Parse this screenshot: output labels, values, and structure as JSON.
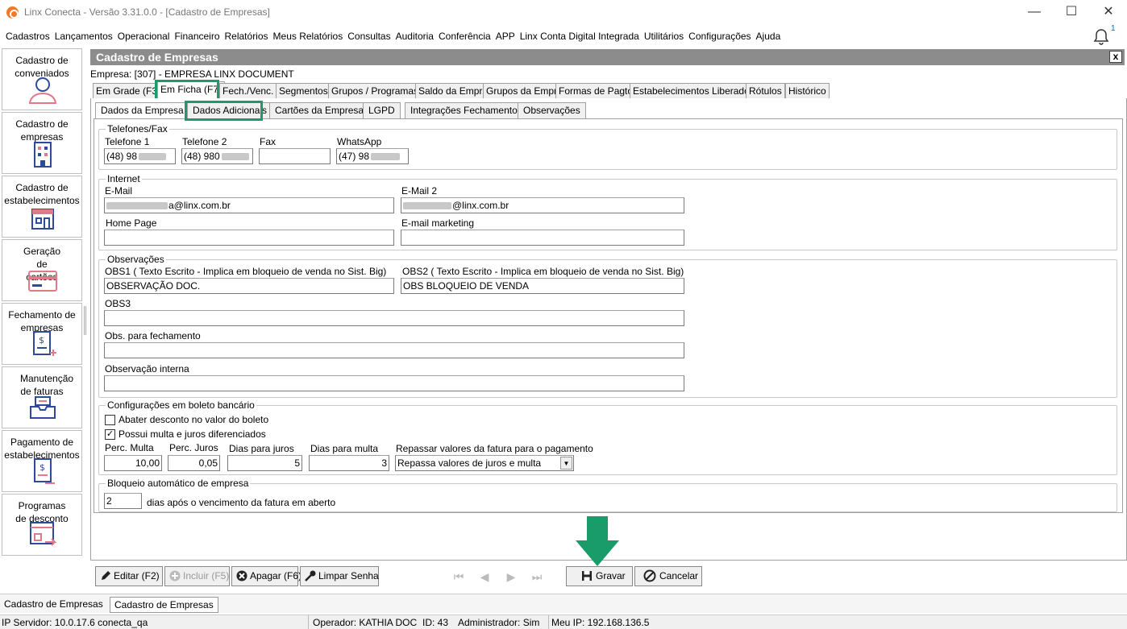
{
  "window": {
    "title": "Linx Conecta - Versão 3.31.0.0 - [Cadastro de Empresas]",
    "minimize": "—",
    "maximize": "☐",
    "close": "✕"
  },
  "menu": [
    "Cadastros",
    "Lançamentos",
    "Operacional",
    "Financeiro",
    "Relatórios",
    "Meus Relatórios",
    "Consultas",
    "Auditoria",
    "Conferência",
    "APP",
    "Linx Conta Digital Integrada",
    "Utilitários",
    "Configurações",
    "Ajuda"
  ],
  "notifications": {
    "count": "1"
  },
  "sidebar": [
    {
      "label": "Cadastro de conveniados",
      "icon": "user-icon"
    },
    {
      "label": "Cadastro de empresas",
      "icon": "building-icon"
    },
    {
      "label": "Cadastro de estabelecimentos",
      "icon": "store-icon"
    },
    {
      "label": "Geração de cartões",
      "icon": "card-icon"
    },
    {
      "label": "Fechamento de empresas",
      "icon": "invoice-icon"
    },
    {
      "label": "Manutenção de faturas",
      "icon": "inbox-icon"
    },
    {
      "label": "Pagamento de estabelecimentos",
      "icon": "payment-icon"
    },
    {
      "label": "Programas de desconto",
      "icon": "discount-icon"
    }
  ],
  "main": {
    "header": "Cadastro de Empresas",
    "close": "x",
    "empresa": "Empresa: [307] - EMPRESA LINX DOCUMENT"
  },
  "tabs": [
    "Em Grade (F3)",
    "Em Ficha (F7)",
    "Fech./Venc.",
    "Segmentos",
    "Grupos / Programas",
    "Saldo da Empr.",
    "Grupos da Empr.",
    "Formas de Pagto",
    "Estabelecimentos Liberados",
    "Rótulos",
    "Histórico"
  ],
  "subtabs": [
    "Dados da Empresa",
    "Dados Adicionais",
    "Cartões da Empresa",
    "LGPD",
    "Integrações Fechamento",
    "Observações"
  ],
  "telefones": {
    "title": "Telefones/Fax",
    "tel1_label": "Telefone 1",
    "tel1_value": "(48) 98",
    "tel2_label": "Telefone 2",
    "tel2_value": "(48) 980",
    "fax_label": "Fax",
    "fax_value": "",
    "whatsapp_label": "WhatsApp",
    "whatsapp_value": "(47) 98"
  },
  "internet": {
    "title": "Internet",
    "email_label": "E-Mail",
    "email_value": "a@linx.com.br",
    "email2_label": "E-Mail 2",
    "email2_value": "@linx.com.br",
    "homepage_label": "Home Page",
    "homepage_value": "",
    "marketing_label": "E-mail marketing",
    "marketing_value": ""
  },
  "observacoes": {
    "title": "Observações",
    "obs1_label": "OBS1 ( Texto Escrito - Implica em bloqueio de venda no Sist. Big)",
    "obs1_value": "OBSERVAÇÃO DOC.",
    "obs2_label": "OBS2 ( Texto Escrito - Implica em bloqueio de venda no Sist. Big)",
    "obs2_value": "OBS BLOQUEIO DE VENDA",
    "obs3_label": "OBS3",
    "obs3_value": "",
    "fechamento_label": "Obs. para fechamento",
    "fechamento_value": "",
    "interna_label": "Observação interna",
    "interna_value": ""
  },
  "boleto": {
    "title": "Configurações em boleto bancário",
    "abater_label": "Abater desconto no valor do boleto",
    "abater_checked": false,
    "multa_juros_label": "Possui multa e juros diferenciados",
    "multa_juros_checked": true,
    "perc_multa_label": "Perc. Multa",
    "perc_multa_value": "10,00",
    "perc_juros_label": "Perc. Juros",
    "perc_juros_value": "0,05",
    "dias_juros_label": "Dias para juros",
    "dias_juros_value": "5",
    "dias_multa_label": "Dias para multa",
    "dias_multa_value": "3",
    "repassar_label": "Repassar valores da fatura para o pagamento",
    "repassar_value": "Repassa valores de juros e multa",
    "check_mark": "✓",
    "dropdown_arrow": "▼"
  },
  "bloqueio": {
    "title": "Bloqueio automático de empresa",
    "dias_value": "2",
    "dias_suffix": "dias após o vencimento da fatura em aberto"
  },
  "toolbar": {
    "editar": "Editar (F2)",
    "incluir": "Incluir (F5)",
    "apagar": "Apagar (F6)",
    "limpar": "Limpar Senha",
    "nav_first": "⏮",
    "nav_prev": "◀",
    "nav_next": "▶",
    "nav_last": "⏭",
    "gravar": "Gravar",
    "cancelar": "Cancelar"
  },
  "status_tabs": [
    "Cadastro de Empresas",
    "Cadastro de Empresas"
  ],
  "status": {
    "ip_servidor": "IP Servidor: 10.0.17.6 conecta_qa",
    "operador": "Operador: KATHIA DOC",
    "id": "ID: 43",
    "administrador": "Administrador: Sim",
    "meu_ip": "Meu IP: 192.168.136.5"
  },
  "colors": {
    "highlight": "#1a9b6a",
    "header": "#8c8c8c",
    "accent": "#2e4a9a"
  }
}
